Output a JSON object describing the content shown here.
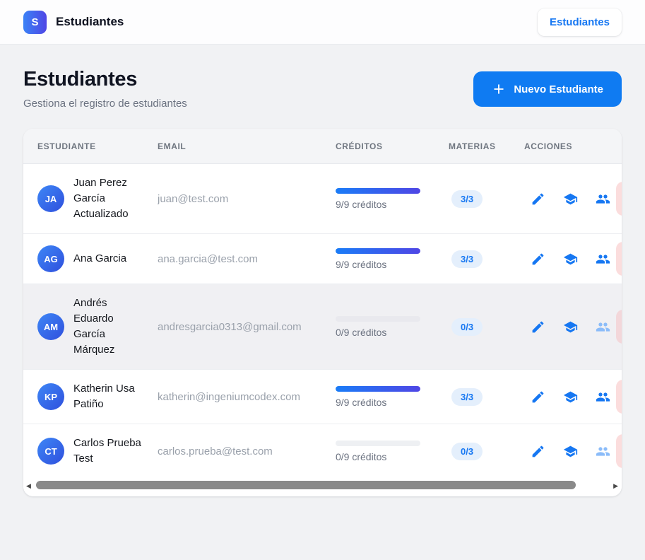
{
  "nav": {
    "logo_letter": "S",
    "app_title": "Estudiantes",
    "nav_button_label": "Estudiantes"
  },
  "header": {
    "title": "Estudiantes",
    "subtitle": "Gestiona el registro de estudiantes",
    "new_button_label": "Nuevo Estudiante"
  },
  "table": {
    "columns": [
      "Estudiante",
      "Email",
      "Créditos",
      "Materias",
      "Acciones"
    ],
    "rows": [
      {
        "initials": "JA",
        "name": "Juan Perez García Actualizado",
        "email": "juan@test.com",
        "credits_label": "9/9 créditos",
        "credits_pct": 100,
        "materias_badge": "3/3",
        "group_enabled": true,
        "highlighted": false
      },
      {
        "initials": "AG",
        "name": "Ana Garcia",
        "email": "ana.garcia@test.com",
        "credits_label": "9/9 créditos",
        "credits_pct": 100,
        "materias_badge": "3/3",
        "group_enabled": true,
        "highlighted": false
      },
      {
        "initials": "AM",
        "name": "Andrés Eduardo García Márquez",
        "email": "andresgarcia0313@gmail.com",
        "credits_label": "0/9 créditos",
        "credits_pct": 0,
        "materias_badge": "0/3",
        "group_enabled": false,
        "highlighted": true
      },
      {
        "initials": "KP",
        "name": "Katherin Usa Patiño",
        "email": "katherin@ingeniumcodex.com",
        "credits_label": "9/9 créditos",
        "credits_pct": 100,
        "materias_badge": "3/3",
        "group_enabled": true,
        "highlighted": false
      },
      {
        "initials": "CT",
        "name": "Carlos Prueba Test",
        "email": "carlos.prueba@test.com",
        "credits_label": "0/9 créditos",
        "credits_pct": 0,
        "materias_badge": "0/3",
        "group_enabled": false,
        "highlighted": false
      }
    ]
  },
  "icons": {
    "plus": "plus-icon",
    "edit": "edit-pencil-icon",
    "subjects": "graduation-cap-icon",
    "group": "people-group-icon",
    "delete": "delete-icon",
    "scroll_left": "scroll-left-arrow-icon",
    "scroll_right": "scroll-right-arrow-icon"
  },
  "colors": {
    "accent_blue": "#0f7bf2",
    "icon_blue": "#1677f2",
    "icon_blue_disabled": "#8bbcf9",
    "progress_gradient_start": "#1a7cf7",
    "progress_gradient_end": "#4f46e5",
    "avatar_gradient_start": "#3e87f6",
    "avatar_gradient_end": "#2f4fdd",
    "badge_bg": "#e4effc",
    "badge_text": "#1677f2",
    "delete_pink": "#fbdddd",
    "page_bg": "#f1f2f4",
    "row_highlight": "#f0f0f3"
  }
}
